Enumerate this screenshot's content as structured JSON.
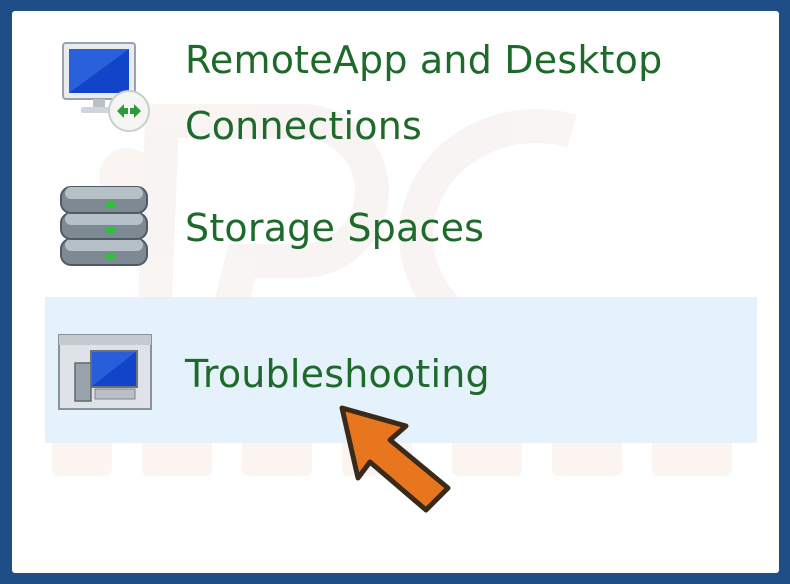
{
  "items": [
    {
      "label_line1": "RemoteApp and Desktop",
      "label_line2": "Connections",
      "icon": "remoteapp-icon"
    },
    {
      "label": "Storage Spaces",
      "icon": "storage-spaces-icon"
    },
    {
      "label": "Troubleshooting",
      "icon": "troubleshooting-icon"
    }
  ],
  "colors": {
    "link_text": "#1d6a2a",
    "hover_highlight": "#e5f1fb",
    "frame": "#1f4e86",
    "arrow": "#e8761f"
  },
  "annotation": {
    "icon": "pointer-arrow-icon"
  }
}
